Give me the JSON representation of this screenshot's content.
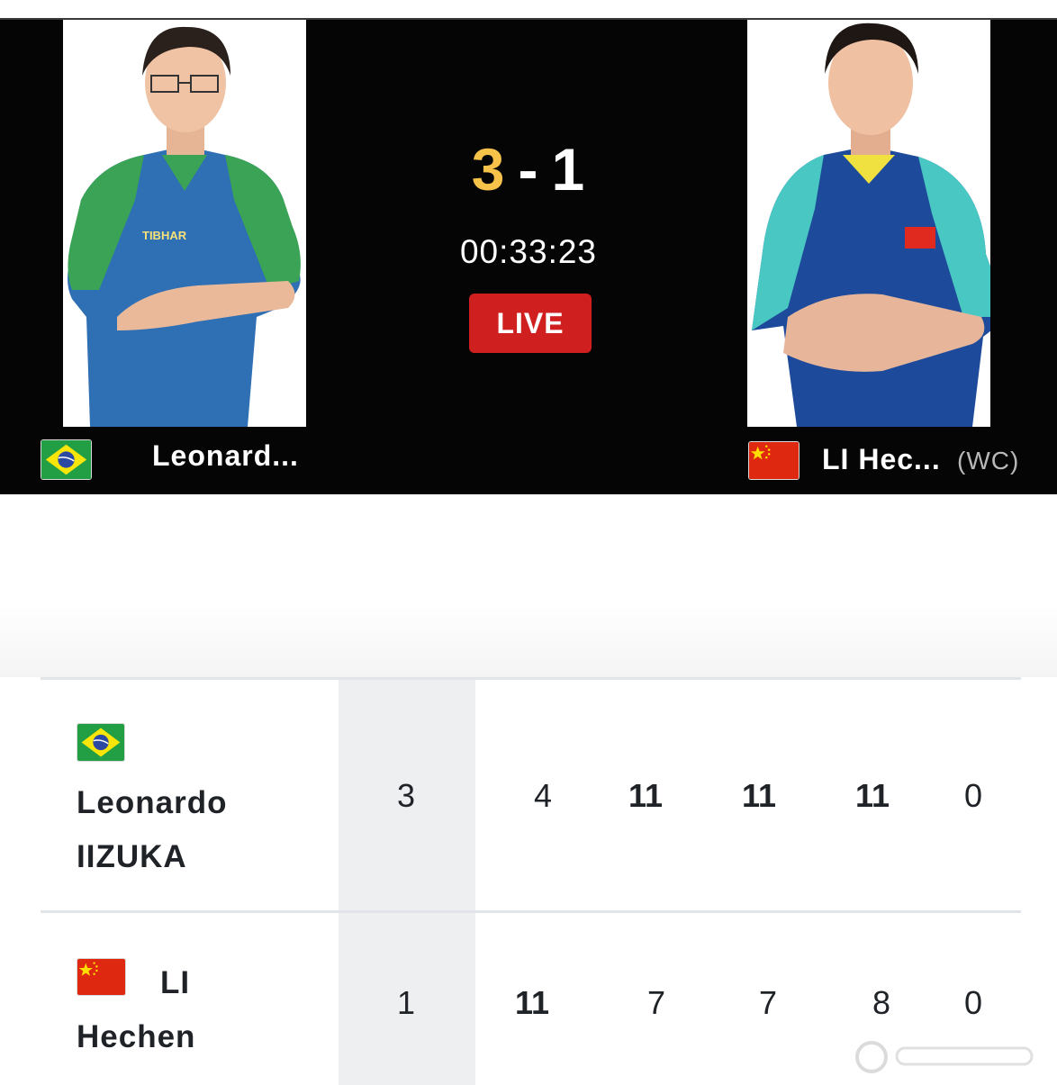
{
  "match": {
    "score_left": "3",
    "score_sep": "-",
    "score_right": "1",
    "clock": "00:33:23",
    "status": "LIVE"
  },
  "players": [
    {
      "short_name": "Leonard...",
      "name_line1": "Leonardo",
      "name_line2": "IIZUKA",
      "flag": "brazil-flag",
      "sets": "3",
      "games": [
        "4",
        "11",
        "11",
        "11",
        "0"
      ],
      "bold_games": [
        false,
        true,
        true,
        true,
        false
      ]
    },
    {
      "short_name": "LI Hec...",
      "seed": "(WC)",
      "name_line1": "LI",
      "name_line2": "Hechen",
      "flag": "china-flag",
      "sets": "1",
      "games": [
        "11",
        "7",
        "7",
        "8",
        "0"
      ],
      "bold_games": [
        true,
        false,
        false,
        false,
        false
      ]
    }
  ],
  "colors": {
    "header_bg": "#050505",
    "score_highlight": "#f6c24a",
    "live_red": "#d01f1f",
    "sets_column_bg": "#eeeff1",
    "text_dark": "#1f2328"
  },
  "icons": [
    "brazil-flag",
    "china-flag",
    "watermark-icon"
  ]
}
